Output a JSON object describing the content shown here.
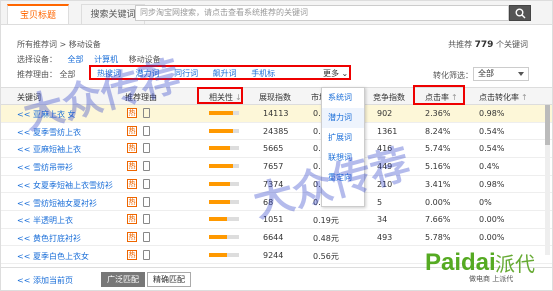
{
  "tabs": {
    "active": "宝贝标题",
    "other": "搜索关键词"
  },
  "search": {
    "placeholder": "同步淘宝网搜索，请点击查看系统推荐的关键词"
  },
  "breadcrumb": "所有推荐词 > 移动设备",
  "count": {
    "prefix": "共推荐",
    "value": "779",
    "suffix": "个关键词"
  },
  "device_filter": {
    "label": "选择设备：",
    "options": [
      "全部",
      "计算机",
      "移动设备"
    ],
    "selected": "移动设备"
  },
  "rec_filter": {
    "label": "推荐理由：",
    "all": "全部",
    "items": [
      "热搜词",
      "潜力词",
      "同行词",
      "飙升词",
      "手机标"
    ],
    "more": "更多"
  },
  "conv_filter": {
    "label": "转化筛选：",
    "value": "全部"
  },
  "table": {
    "headers": [
      "关键词",
      "推荐理由",
      "相关性",
      "展现指数",
      "市场",
      "竞争指数",
      "点击率",
      "点击转化率"
    ],
    "rows": [
      {
        "kw": "<< 亚麻上衣 女",
        "imp": "14113",
        "price": "0.",
        "comp": "902",
        "ctr": "2.36%",
        "cvr": "0.98%"
      },
      {
        "kw": "<< 夏季雪纺上衣",
        "imp": "24385",
        "price": "0.5",
        "comp": "1361",
        "ctr": "8.24%",
        "cvr": "0.54%"
      },
      {
        "kw": "<< 亚麻短袖上衣",
        "imp": "5665",
        "price": "0.2",
        "comp": "416",
        "ctr": "5.74%",
        "cvr": "0.54%"
      },
      {
        "kw": "<< 雪纺吊带衫",
        "imp": "7657",
        "price": "0.4",
        "comp": "449",
        "ctr": "5.16%",
        "cvr": "0.4%"
      },
      {
        "kw": "<< 女夏季短袖上衣雪纺衫",
        "imp": "7374",
        "price": "0.2",
        "comp": "210",
        "ctr": "3.41%",
        "cvr": "0.98%"
      },
      {
        "kw": "<< 雪纺短袖女夏衬衫",
        "imp": "68",
        "price": "0.0",
        "comp": "5",
        "ctr": "0.00%",
        "cvr": "0%"
      },
      {
        "kw": "<< 半透明上衣",
        "imp": "1051",
        "price": "0.19元",
        "comp": "34",
        "ctr": "7.66%",
        "cvr": "0.00%"
      },
      {
        "kw": "<< 黄色打底衬衫",
        "imp": "6644",
        "price": "0.48元",
        "comp": "493",
        "ctr": "5.78%",
        "cvr": "0.00%"
      },
      {
        "kw": "<< 夏季白色上衣女",
        "imp": "9244",
        "price": "0.56元",
        "comp": "",
        "ctr": "",
        "cvr": ""
      }
    ]
  },
  "popup": {
    "items": [
      "系统词",
      "潜力词",
      "扩展词",
      "联想词",
      "重定向"
    ]
  },
  "footer": {
    "add": "<< 添加当前页",
    "btn1": "广泛匹配",
    "btn2": "精确匹配"
  },
  "watermark": "大众传荐",
  "logo": {
    "text": "Paidai",
    "cn": "派代",
    "sub": "做电商 上派代"
  },
  "colors": {
    "accent": "#ff6600",
    "link": "#1a6ed8",
    "highlight": "#e00000"
  }
}
